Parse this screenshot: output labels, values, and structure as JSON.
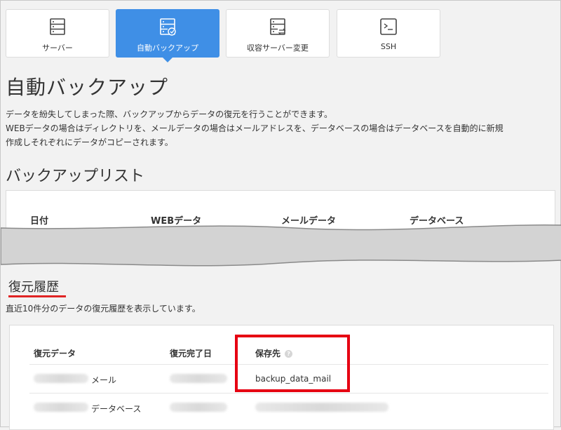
{
  "tabs": [
    {
      "label": "サーバー",
      "icon": "server-list-icon",
      "active": false
    },
    {
      "label": "自動バックアップ",
      "icon": "auto-backup-icon",
      "active": true
    },
    {
      "label": "収容サーバー変更",
      "icon": "server-change-icon",
      "active": false
    },
    {
      "label": "SSH",
      "icon": "terminal-icon",
      "active": false
    }
  ],
  "page": {
    "title": "自動バックアップ",
    "description": [
      "データを紛失してしまった際、バックアップからデータの復元を行うことができます。",
      "WEBデータの場合はディレクトリを、メールデータの場合はメールアドレスを、データベースの場合はデータベースを自動的に新規",
      "作成しそれぞれにデータがコピーされます。"
    ]
  },
  "backup_list": {
    "heading": "バックアップリスト",
    "columns": [
      "日付",
      "WEBデータ",
      "メールデータ",
      "データベース"
    ]
  },
  "restore_history": {
    "heading": "復元履歴",
    "description": "直近10件分のデータの復元履歴を表示しています。",
    "columns": [
      "復元データ",
      "復元完了日",
      "保存先"
    ],
    "help_mark": "?",
    "rows": [
      {
        "type": "メール",
        "destination": "backup_data_mail"
      },
      {
        "type": "データベース",
        "destination": ""
      }
    ]
  },
  "colors": {
    "accent": "#3f8fe6",
    "highlight": "#e60012",
    "underline": "#e02424"
  }
}
